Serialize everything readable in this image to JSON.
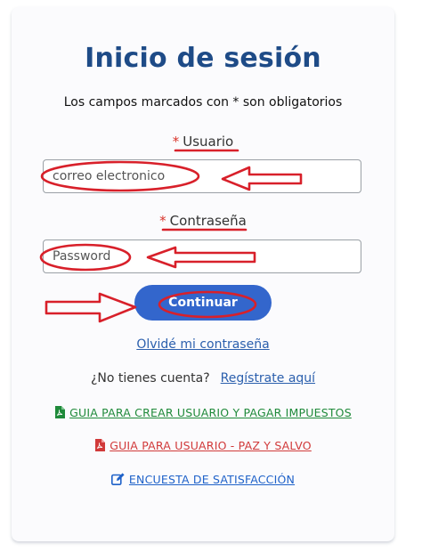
{
  "page": {
    "title": "Inicio de sesión",
    "subtitle": "Los campos marcados con * son obligatorios"
  },
  "form": {
    "user": {
      "required_mark": "*",
      "label": "Usuario",
      "placeholder": "correo electronico",
      "value": ""
    },
    "password": {
      "required_mark": "*",
      "label": "Contraseña",
      "placeholder": "Password",
      "value": ""
    },
    "submit_label": "Continuar"
  },
  "links": {
    "forgot_password": "Olvidé mi contraseña",
    "no_account_text": "¿No tienes cuenta?",
    "register": "Regístrate aquí",
    "guide_create_user": "GUIA PARA CREAR USUARIO Y PAGAR IMPUESTOS",
    "guide_paz_y_salvo": "GUIA PARA USUARIO - PAZ Y SALVO",
    "survey": "ENCUESTA DE SATISFACCIÓN"
  },
  "icons": {
    "guide_create_user": "pdf-icon",
    "guide_paz_y_salvo": "pdf-icon",
    "survey": "edit-icon"
  },
  "colors": {
    "title": "#1e4b87",
    "primary_button": "#3366cc",
    "link": "#2b5fad",
    "guide_green": "#1f8a3a",
    "guide_red": "#d13a3a",
    "survey_blue": "#1f62c9",
    "annotation_red": "#d8202a"
  }
}
